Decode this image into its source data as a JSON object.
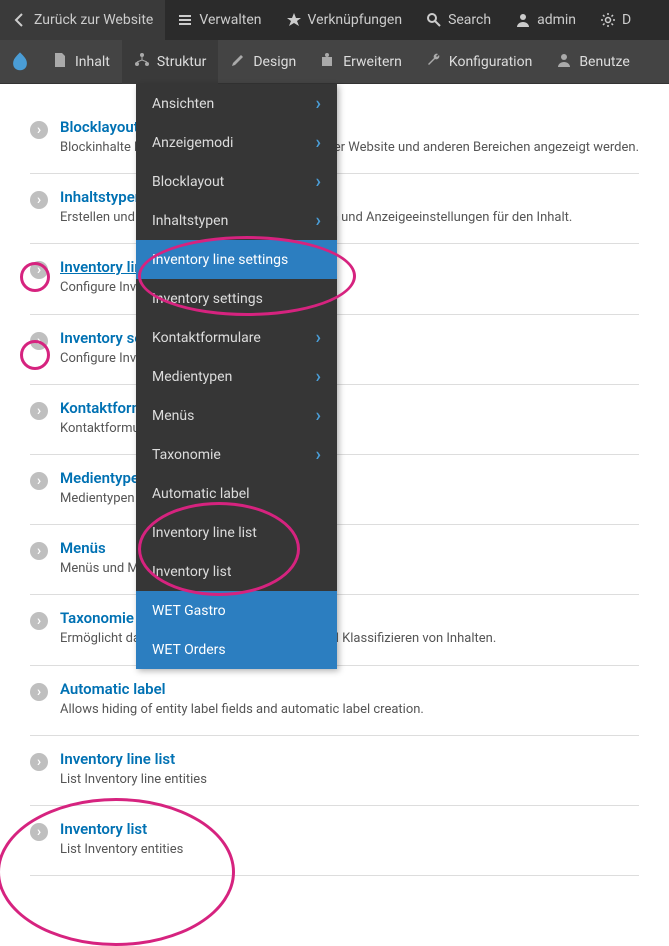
{
  "admin_bar": {
    "back": "Zurück zur Website",
    "manage": "Verwalten",
    "shortcuts": "Verknüpfungen",
    "search": "Search",
    "user": "admin"
  },
  "menu_bar": {
    "content": "Inhalt",
    "structure": "Struktur",
    "design": "Design",
    "extend": "Erweitern",
    "config": "Konfiguration",
    "users": "Benutze"
  },
  "dropdown": [
    {
      "label": "Ansichten",
      "arrow": true,
      "active": false
    },
    {
      "label": "Anzeigemodi",
      "arrow": true,
      "active": false
    },
    {
      "label": "Blocklayout",
      "arrow": true,
      "active": false
    },
    {
      "label": "Inhaltstypen",
      "arrow": true,
      "active": false
    },
    {
      "label": "Inventory line settings",
      "arrow": false,
      "active": true
    },
    {
      "label": "Inventory settings",
      "arrow": false,
      "active": false
    },
    {
      "label": "Kontaktformulare",
      "arrow": true,
      "active": false
    },
    {
      "label": "Medientypen",
      "arrow": true,
      "active": false
    },
    {
      "label": "Menüs",
      "arrow": true,
      "active": false
    },
    {
      "label": "Taxonomie",
      "arrow": true,
      "active": false
    },
    {
      "label": "Automatic label",
      "arrow": false,
      "active": false
    },
    {
      "label": "Inventory line list",
      "arrow": false,
      "active": false
    },
    {
      "label": "Inventory list",
      "arrow": false,
      "active": false
    },
    {
      "label": "WET Gastro",
      "arrow": false,
      "active": false,
      "highlighted": true
    },
    {
      "label": "WET Orders",
      "arrow": false,
      "active": false,
      "highlighted": true
    }
  ],
  "content_items": [
    {
      "title": "Blocklayout",
      "desc": "Blockinhalte konfigurieren, die in der Sidebar Ihrer Website und anderen Bereichen angezeigt werden.",
      "underline": false
    },
    {
      "title": "Inhaltstypen",
      "desc": "Erstellen und Verwalten von Feldern, Formularen und Anzeigeeinstellungen für den Inhalt.",
      "underline": false
    },
    {
      "title": "Inventory line settings",
      "desc": "Configure Inventory line",
      "underline": true
    },
    {
      "title": "Inventory settings",
      "desc": "Configure Inventory",
      "underline": false
    },
    {
      "title": "Kontaktformulare",
      "desc": "Kontaktformulare erstellen und verwalten.",
      "underline": false
    },
    {
      "title": "Medientypen",
      "desc": "Medientypen verwalten.",
      "underline": false
    },
    {
      "title": "Menüs",
      "desc": "Menüs und Menüeinträge verwalten.",
      "underline": false
    },
    {
      "title": "Taxonomie",
      "desc": "Ermöglicht das Identifizieren, Kategorisieren und Klassifizieren von Inhalten.",
      "underline": false
    },
    {
      "title": "Automatic label",
      "desc": "Allows hiding of entity label fields and automatic label creation.",
      "underline": false
    },
    {
      "title": "Inventory line list",
      "desc": "List Inventory line entities",
      "underline": false
    },
    {
      "title": "Inventory list",
      "desc": "List Inventory entities",
      "underline": false
    }
  ]
}
